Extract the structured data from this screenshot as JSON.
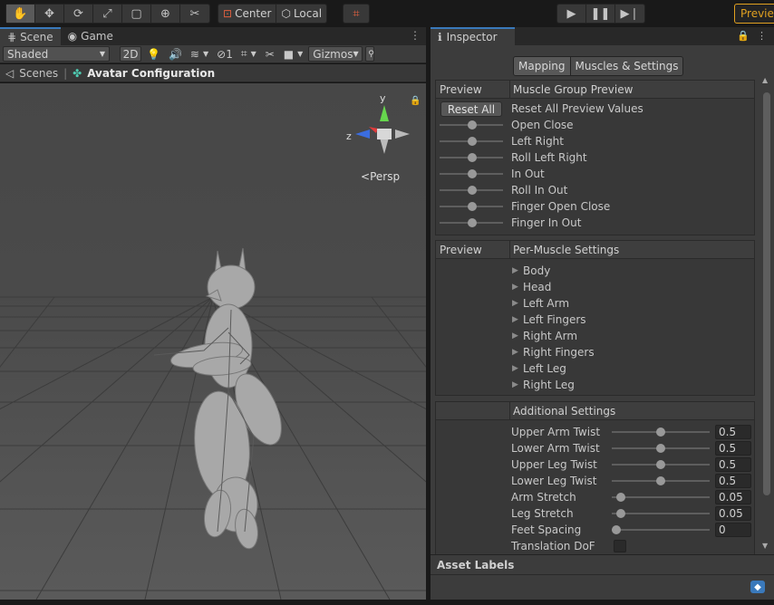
{
  "toolbar": {
    "tools": [
      {
        "icon": "hand-icon",
        "glyph": "✋",
        "active": true
      },
      {
        "icon": "move-icon",
        "glyph": "✥"
      },
      {
        "icon": "rotate-icon",
        "glyph": "⟳"
      },
      {
        "icon": "scale-icon",
        "glyph": "⤢"
      },
      {
        "icon": "rect-icon",
        "glyph": "▢"
      },
      {
        "icon": "transform-icon",
        "glyph": "⊕"
      },
      {
        "icon": "custom-tool-icon",
        "glyph": "✂"
      }
    ],
    "pivot_label": "Center",
    "space_label": "Local",
    "preview_badge": "Previe"
  },
  "scene": {
    "tabs": [
      {
        "label": "Scene",
        "icon": "grid-icon"
      },
      {
        "label": "Game",
        "icon": "gamepad-icon"
      }
    ],
    "shading": "Shaded",
    "mode_2d": "2D",
    "hidden_count": "1",
    "gizmos": "Gizmos",
    "breadcrumb": {
      "root": "Scenes",
      "current": "Avatar Configuration"
    },
    "gizmo": {
      "y": "y",
      "z": "z",
      "projection": "Persp"
    }
  },
  "inspector": {
    "title": "Inspector",
    "tabs": [
      "Mapping",
      "Muscles & Settings"
    ],
    "muscle_group": {
      "head_left": "Preview",
      "head_right": "Muscle Group Preview",
      "reset_button": "Reset All",
      "reset_label": "Reset All Preview Values",
      "items": [
        "Open Close",
        "Left Right",
        "Roll Left Right",
        "In Out",
        "Roll In Out",
        "Finger Open Close",
        "Finger In Out"
      ]
    },
    "per_muscle": {
      "head_left": "Preview",
      "head_right": "Per-Muscle Settings",
      "items": [
        "Body",
        "Head",
        "Left Arm",
        "Left Fingers",
        "Right Arm",
        "Right Fingers",
        "Left Leg",
        "Right Leg"
      ]
    },
    "additional": {
      "head_right": "Additional Settings",
      "items": [
        {
          "label": "Upper Arm Twist",
          "value": "0.5",
          "fraction": 0.5
        },
        {
          "label": "Lower Arm Twist",
          "value": "0.5",
          "fraction": 0.5
        },
        {
          "label": "Upper Leg Twist",
          "value": "0.5",
          "fraction": 0.5
        },
        {
          "label": "Lower Leg Twist",
          "value": "0.5",
          "fraction": 0.5
        },
        {
          "label": "Arm Stretch",
          "value": "0.05",
          "fraction": 0.05
        },
        {
          "label": "Leg Stretch",
          "value": "0.05",
          "fraction": 0.05
        },
        {
          "label": "Feet Spacing",
          "value": "0",
          "fraction": 0.0
        }
      ],
      "dof_label": "Translation DoF"
    },
    "asset_labels": "Asset Labels"
  },
  "colors": {
    "accent": "#3a79bb",
    "warning": "#e0a020"
  }
}
